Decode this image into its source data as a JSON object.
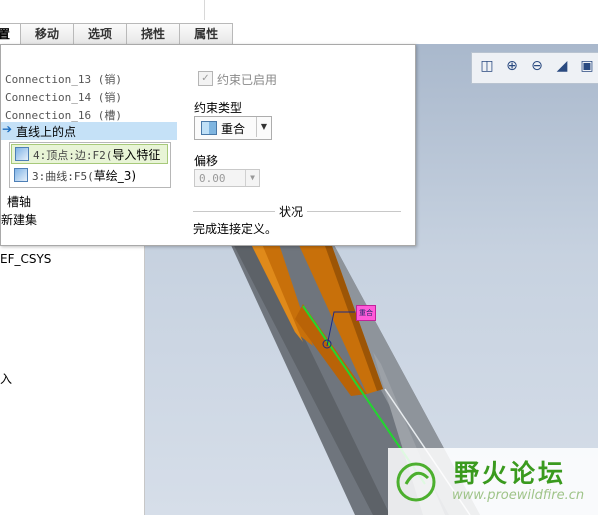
{
  "tabs": [
    "置",
    "移动",
    "选项",
    "挠性",
    "属性"
  ],
  "panel": {
    "connections": [
      "Connection_13 (销)",
      "Connection_14 (销)",
      "Connection_16 (槽)"
    ],
    "selected_constraint": "直线上的点",
    "references": [
      {
        "prefix": "4:顶点:边:F2(",
        "text": "导入特征"
      },
      {
        "prefix": "3:曲线:F5(",
        "text": "草绘_3)"
      }
    ],
    "misc_items": [
      "槽轴",
      "新建集"
    ],
    "constraint_enabled_label": "约束已启用",
    "constraint_type_label": "约束类型",
    "constraint_type_value": "重合",
    "offset_label": "偏移",
    "offset_value": "0.00",
    "status_title": "状况",
    "status_text": "完成连接定义。"
  },
  "tree": {
    "item": "EF_CSYS",
    "cut_char": "入"
  },
  "viewport": {
    "annotation_tag": "重合",
    "watermark_title": "野火论坛",
    "watermark_url": "www.proewildfire.cn"
  },
  "colors": {
    "selection": "#c5e1f7",
    "part_orange": "#c8700a",
    "axis_green": "#23d630",
    "tag_magenta": "#ff5ad8",
    "watermark_green": "#4caf2e"
  }
}
